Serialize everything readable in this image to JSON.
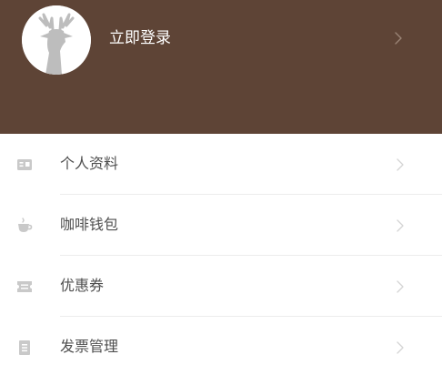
{
  "header": {
    "login_label": "立即登录",
    "background_color": "#5e4436",
    "avatar_icon": "deer-head-icon",
    "chevron_icon": "chevron-right-icon"
  },
  "menu": {
    "items": [
      {
        "label": "个人资料",
        "icon": "id-card-icon"
      },
      {
        "label": "咖啡钱包",
        "icon": "coffee-cup-icon"
      },
      {
        "label": "优惠券",
        "icon": "ticket-icon"
      },
      {
        "label": "发票管理",
        "icon": "invoice-icon"
      }
    ],
    "icon_color": "#c9c9c9",
    "chevron_color": "#d4d4d4"
  }
}
